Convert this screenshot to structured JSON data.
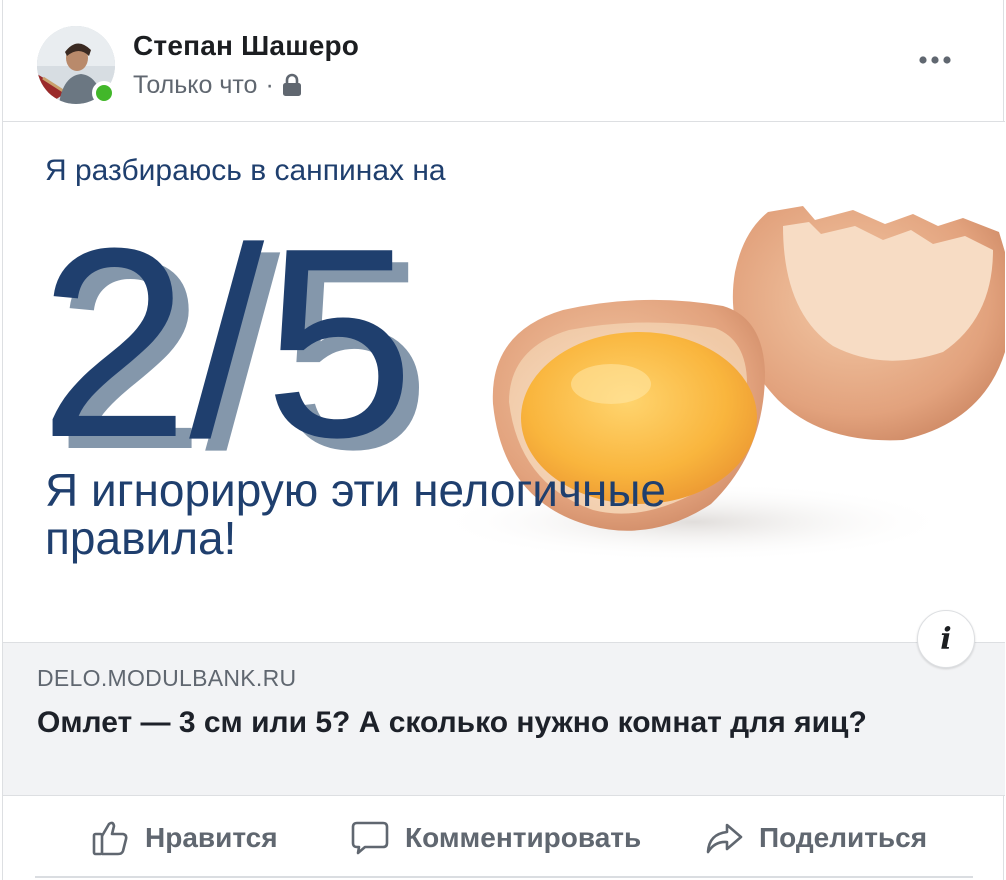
{
  "post": {
    "author": "Степан Шашеро",
    "timestamp": "Только что",
    "separator": "·",
    "privacy_icon": "lock-icon",
    "more_icon": "more-icon"
  },
  "image": {
    "top_text": "Я разбираюсь в санпинах на",
    "big_text": "2/5",
    "bottom_line1": "Я игнорирую эти нелогичные",
    "bottom_line2": "правила!",
    "info_label": "i"
  },
  "link": {
    "domain": "DELO.MODULBANK.RU",
    "title": "Омлет — 3 см или 5? А сколько нужно комнат для яиц?"
  },
  "actions": {
    "like": "Нравится",
    "comment": "Комментировать",
    "share": "Поделиться"
  },
  "colors": {
    "navy": "#1f3f6e",
    "shadow": "#8497ab",
    "online": "#42b72a",
    "muted": "#606770"
  }
}
